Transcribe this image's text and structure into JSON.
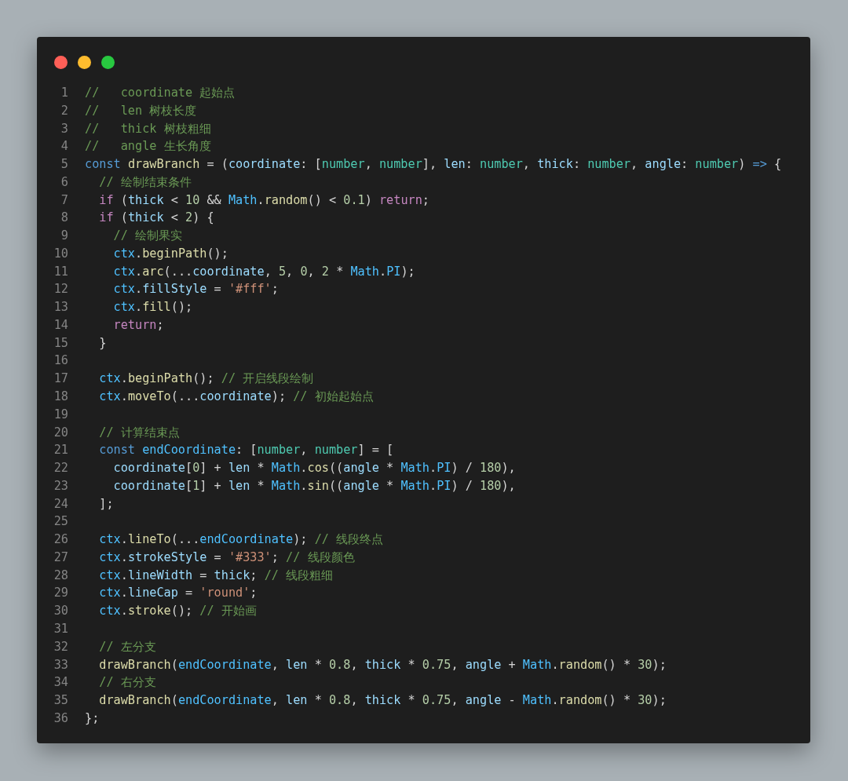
{
  "window": {
    "controls": [
      {
        "kind": "close"
      },
      {
        "kind": "minimize"
      },
      {
        "kind": "maximize"
      }
    ]
  },
  "lines": [
    {
      "number": "1",
      "tokens": [
        {
          "kind": "comment",
          "text": "//   coordinate 起始点"
        }
      ]
    },
    {
      "number": "2",
      "tokens": [
        {
          "kind": "comment",
          "text": "//   len 树枝长度"
        }
      ]
    },
    {
      "number": "3",
      "tokens": [
        {
          "kind": "comment",
          "text": "//   thick 树枝粗细"
        }
      ]
    },
    {
      "number": "4",
      "tokens": [
        {
          "kind": "comment",
          "text": "//   angle 生长角度"
        }
      ]
    },
    {
      "number": "5",
      "tokens": [
        {
          "kind": "keyword",
          "text": "const "
        },
        {
          "kind": "func",
          "text": "drawBranch"
        },
        {
          "kind": "punct",
          "text": " = ("
        },
        {
          "kind": "var",
          "text": "coordinate"
        },
        {
          "kind": "punct",
          "text": ": ["
        },
        {
          "kind": "type",
          "text": "number"
        },
        {
          "kind": "punct",
          "text": ", "
        },
        {
          "kind": "type",
          "text": "number"
        },
        {
          "kind": "punct",
          "text": "], "
        },
        {
          "kind": "var",
          "text": "len"
        },
        {
          "kind": "punct",
          "text": ": "
        },
        {
          "kind": "type",
          "text": "number"
        },
        {
          "kind": "punct",
          "text": ", "
        },
        {
          "kind": "var",
          "text": "thick"
        },
        {
          "kind": "punct",
          "text": ": "
        },
        {
          "kind": "type",
          "text": "number"
        },
        {
          "kind": "punct",
          "text": ", "
        },
        {
          "kind": "var",
          "text": "angle"
        },
        {
          "kind": "punct",
          "text": ": "
        },
        {
          "kind": "type",
          "text": "number"
        },
        {
          "kind": "punct",
          "text": ") "
        },
        {
          "kind": "keyword",
          "text": "=>"
        },
        {
          "kind": "punct",
          "text": " {"
        }
      ]
    },
    {
      "number": "6",
      "tokens": [
        {
          "kind": "comment",
          "text": "  // 绘制结束条件"
        }
      ]
    },
    {
      "number": "7",
      "tokens": [
        {
          "kind": "control",
          "text": "  if"
        },
        {
          "kind": "punct",
          "text": " ("
        },
        {
          "kind": "var",
          "text": "thick"
        },
        {
          "kind": "punct",
          "text": " < "
        },
        {
          "kind": "number",
          "text": "10"
        },
        {
          "kind": "punct",
          "text": " && "
        },
        {
          "kind": "const",
          "text": "Math"
        },
        {
          "kind": "punct",
          "text": "."
        },
        {
          "kind": "func",
          "text": "random"
        },
        {
          "kind": "punct",
          "text": "() < "
        },
        {
          "kind": "number",
          "text": "0.1"
        },
        {
          "kind": "punct",
          "text": ") "
        },
        {
          "kind": "control",
          "text": "return"
        },
        {
          "kind": "punct",
          "text": ";"
        }
      ]
    },
    {
      "number": "8",
      "tokens": [
        {
          "kind": "control",
          "text": "  if"
        },
        {
          "kind": "punct",
          "text": " ("
        },
        {
          "kind": "var",
          "text": "thick"
        },
        {
          "kind": "punct",
          "text": " < "
        },
        {
          "kind": "number",
          "text": "2"
        },
        {
          "kind": "punct",
          "text": ") {"
        }
      ]
    },
    {
      "number": "9",
      "tokens": [
        {
          "kind": "comment",
          "text": "    // 绘制果实"
        }
      ]
    },
    {
      "number": "10",
      "tokens": [
        {
          "kind": "const",
          "text": "    ctx"
        },
        {
          "kind": "punct",
          "text": "."
        },
        {
          "kind": "func",
          "text": "beginPath"
        },
        {
          "kind": "punct",
          "text": "();"
        }
      ]
    },
    {
      "number": "11",
      "tokens": [
        {
          "kind": "const",
          "text": "    ctx"
        },
        {
          "kind": "punct",
          "text": "."
        },
        {
          "kind": "func",
          "text": "arc"
        },
        {
          "kind": "punct",
          "text": "(..."
        },
        {
          "kind": "var",
          "text": "coordinate"
        },
        {
          "kind": "punct",
          "text": ", "
        },
        {
          "kind": "number",
          "text": "5"
        },
        {
          "kind": "punct",
          "text": ", "
        },
        {
          "kind": "number",
          "text": "0"
        },
        {
          "kind": "punct",
          "text": ", "
        },
        {
          "kind": "number",
          "text": "2"
        },
        {
          "kind": "punct",
          "text": " * "
        },
        {
          "kind": "const",
          "text": "Math"
        },
        {
          "kind": "punct",
          "text": "."
        },
        {
          "kind": "const",
          "text": "PI"
        },
        {
          "kind": "punct",
          "text": ");"
        }
      ]
    },
    {
      "number": "12",
      "tokens": [
        {
          "kind": "const",
          "text": "    ctx"
        },
        {
          "kind": "punct",
          "text": "."
        },
        {
          "kind": "var",
          "text": "fillStyle"
        },
        {
          "kind": "punct",
          "text": " = "
        },
        {
          "kind": "string",
          "text": "'#fff'"
        },
        {
          "kind": "punct",
          "text": ";"
        }
      ]
    },
    {
      "number": "13",
      "tokens": [
        {
          "kind": "const",
          "text": "    ctx"
        },
        {
          "kind": "punct",
          "text": "."
        },
        {
          "kind": "func",
          "text": "fill"
        },
        {
          "kind": "punct",
          "text": "();"
        }
      ]
    },
    {
      "number": "14",
      "tokens": [
        {
          "kind": "control",
          "text": "    return"
        },
        {
          "kind": "punct",
          "text": ";"
        }
      ]
    },
    {
      "number": "15",
      "tokens": [
        {
          "kind": "punct",
          "text": "  }"
        }
      ]
    },
    {
      "number": "16"
    },
    {
      "number": "17",
      "tokens": [
        {
          "kind": "const",
          "text": "  ctx"
        },
        {
          "kind": "punct",
          "text": "."
        },
        {
          "kind": "func",
          "text": "beginPath"
        },
        {
          "kind": "punct",
          "text": "(); "
        },
        {
          "kind": "comment",
          "text": "// 开启线段绘制"
        }
      ]
    },
    {
      "number": "18",
      "tokens": [
        {
          "kind": "const",
          "text": "  ctx"
        },
        {
          "kind": "punct",
          "text": "."
        },
        {
          "kind": "func",
          "text": "moveTo"
        },
        {
          "kind": "punct",
          "text": "(..."
        },
        {
          "kind": "var",
          "text": "coordinate"
        },
        {
          "kind": "punct",
          "text": "); "
        },
        {
          "kind": "comment",
          "text": "// 初始起始点"
        }
      ]
    },
    {
      "number": "19"
    },
    {
      "number": "20",
      "tokens": [
        {
          "kind": "comment",
          "text": "  // 计算结束点"
        }
      ]
    },
    {
      "number": "21",
      "tokens": [
        {
          "kind": "keyword",
          "text": "  const "
        },
        {
          "kind": "const",
          "text": "endCoordinate"
        },
        {
          "kind": "punct",
          "text": ": ["
        },
        {
          "kind": "type",
          "text": "number"
        },
        {
          "kind": "punct",
          "text": ", "
        },
        {
          "kind": "type",
          "text": "number"
        },
        {
          "kind": "punct",
          "text": "] = ["
        }
      ]
    },
    {
      "number": "22",
      "tokens": [
        {
          "kind": "var",
          "text": "    coordinate"
        },
        {
          "kind": "punct",
          "text": "["
        },
        {
          "kind": "number",
          "text": "0"
        },
        {
          "kind": "punct",
          "text": "] + "
        },
        {
          "kind": "var",
          "text": "len"
        },
        {
          "kind": "punct",
          "text": " * "
        },
        {
          "kind": "const",
          "text": "Math"
        },
        {
          "kind": "punct",
          "text": "."
        },
        {
          "kind": "func",
          "text": "cos"
        },
        {
          "kind": "punct",
          "text": "(("
        },
        {
          "kind": "var",
          "text": "angle"
        },
        {
          "kind": "punct",
          "text": " * "
        },
        {
          "kind": "const",
          "text": "Math"
        },
        {
          "kind": "punct",
          "text": "."
        },
        {
          "kind": "const",
          "text": "PI"
        },
        {
          "kind": "punct",
          "text": ") / "
        },
        {
          "kind": "number",
          "text": "180"
        },
        {
          "kind": "punct",
          "text": "),"
        }
      ]
    },
    {
      "number": "23",
      "tokens": [
        {
          "kind": "var",
          "text": "    coordinate"
        },
        {
          "kind": "punct",
          "text": "["
        },
        {
          "kind": "number",
          "text": "1"
        },
        {
          "kind": "punct",
          "text": "] + "
        },
        {
          "kind": "var",
          "text": "len"
        },
        {
          "kind": "punct",
          "text": " * "
        },
        {
          "kind": "const",
          "text": "Math"
        },
        {
          "kind": "punct",
          "text": "."
        },
        {
          "kind": "func",
          "text": "sin"
        },
        {
          "kind": "punct",
          "text": "(("
        },
        {
          "kind": "var",
          "text": "angle"
        },
        {
          "kind": "punct",
          "text": " * "
        },
        {
          "kind": "const",
          "text": "Math"
        },
        {
          "kind": "punct",
          "text": "."
        },
        {
          "kind": "const",
          "text": "PI"
        },
        {
          "kind": "punct",
          "text": ") / "
        },
        {
          "kind": "number",
          "text": "180"
        },
        {
          "kind": "punct",
          "text": "),"
        }
      ]
    },
    {
      "number": "24",
      "tokens": [
        {
          "kind": "punct",
          "text": "  ];"
        }
      ]
    },
    {
      "number": "25"
    },
    {
      "number": "26",
      "tokens": [
        {
          "kind": "const",
          "text": "  ctx"
        },
        {
          "kind": "punct",
          "text": "."
        },
        {
          "kind": "func",
          "text": "lineTo"
        },
        {
          "kind": "punct",
          "text": "(..."
        },
        {
          "kind": "const",
          "text": "endCoordinate"
        },
        {
          "kind": "punct",
          "text": "); "
        },
        {
          "kind": "comment",
          "text": "// 线段终点"
        }
      ]
    },
    {
      "number": "27",
      "tokens": [
        {
          "kind": "const",
          "text": "  ctx"
        },
        {
          "kind": "punct",
          "text": "."
        },
        {
          "kind": "var",
          "text": "strokeStyle"
        },
        {
          "kind": "punct",
          "text": " = "
        },
        {
          "kind": "string",
          "text": "'#333'"
        },
        {
          "kind": "punct",
          "text": "; "
        },
        {
          "kind": "comment",
          "text": "// 线段颜色"
        }
      ]
    },
    {
      "number": "28",
      "tokens": [
        {
          "kind": "const",
          "text": "  ctx"
        },
        {
          "kind": "punct",
          "text": "."
        },
        {
          "kind": "var",
          "text": "lineWidth"
        },
        {
          "kind": "punct",
          "text": " = "
        },
        {
          "kind": "var",
          "text": "thick"
        },
        {
          "kind": "punct",
          "text": "; "
        },
        {
          "kind": "comment",
          "text": "// 线段粗细"
        }
      ]
    },
    {
      "number": "29",
      "tokens": [
        {
          "kind": "const",
          "text": "  ctx"
        },
        {
          "kind": "punct",
          "text": "."
        },
        {
          "kind": "var",
          "text": "lineCap"
        },
        {
          "kind": "punct",
          "text": " = "
        },
        {
          "kind": "string",
          "text": "'round'"
        },
        {
          "kind": "punct",
          "text": ";"
        }
      ]
    },
    {
      "number": "30",
      "tokens": [
        {
          "kind": "const",
          "text": "  ctx"
        },
        {
          "kind": "punct",
          "text": "."
        },
        {
          "kind": "func",
          "text": "stroke"
        },
        {
          "kind": "punct",
          "text": "(); "
        },
        {
          "kind": "comment",
          "text": "// 开始画"
        }
      ]
    },
    {
      "number": "31"
    },
    {
      "number": "32",
      "tokens": [
        {
          "kind": "comment",
          "text": "  // 左分支"
        }
      ]
    },
    {
      "number": "33",
      "tokens": [
        {
          "kind": "func",
          "text": "  drawBranch"
        },
        {
          "kind": "punct",
          "text": "("
        },
        {
          "kind": "const",
          "text": "endCoordinate"
        },
        {
          "kind": "punct",
          "text": ", "
        },
        {
          "kind": "var",
          "text": "len"
        },
        {
          "kind": "punct",
          "text": " * "
        },
        {
          "kind": "number",
          "text": "0.8"
        },
        {
          "kind": "punct",
          "text": ", "
        },
        {
          "kind": "var",
          "text": "thick"
        },
        {
          "kind": "punct",
          "text": " * "
        },
        {
          "kind": "number",
          "text": "0.75"
        },
        {
          "kind": "punct",
          "text": ", "
        },
        {
          "kind": "var",
          "text": "angle"
        },
        {
          "kind": "punct",
          "text": " + "
        },
        {
          "kind": "const",
          "text": "Math"
        },
        {
          "kind": "punct",
          "text": "."
        },
        {
          "kind": "func",
          "text": "random"
        },
        {
          "kind": "punct",
          "text": "() * "
        },
        {
          "kind": "number",
          "text": "30"
        },
        {
          "kind": "punct",
          "text": ");"
        }
      ]
    },
    {
      "number": "34",
      "tokens": [
        {
          "kind": "comment",
          "text": "  // 右分支"
        }
      ]
    },
    {
      "number": "35",
      "tokens": [
        {
          "kind": "func",
          "text": "  drawBranch"
        },
        {
          "kind": "punct",
          "text": "("
        },
        {
          "kind": "const",
          "text": "endCoordinate"
        },
        {
          "kind": "punct",
          "text": ", "
        },
        {
          "kind": "var",
          "text": "len"
        },
        {
          "kind": "punct",
          "text": " * "
        },
        {
          "kind": "number",
          "text": "0.8"
        },
        {
          "kind": "punct",
          "text": ", "
        },
        {
          "kind": "var",
          "text": "thick"
        },
        {
          "kind": "punct",
          "text": " * "
        },
        {
          "kind": "number",
          "text": "0.75"
        },
        {
          "kind": "punct",
          "text": ", "
        },
        {
          "kind": "var",
          "text": "angle"
        },
        {
          "kind": "punct",
          "text": " - "
        },
        {
          "kind": "const",
          "text": "Math"
        },
        {
          "kind": "punct",
          "text": "."
        },
        {
          "kind": "func",
          "text": "random"
        },
        {
          "kind": "punct",
          "text": "() * "
        },
        {
          "kind": "number",
          "text": "30"
        },
        {
          "kind": "punct",
          "text": ");"
        }
      ]
    },
    {
      "number": "36",
      "tokens": [
        {
          "kind": "punct",
          "text": "};"
        }
      ]
    }
  ]
}
